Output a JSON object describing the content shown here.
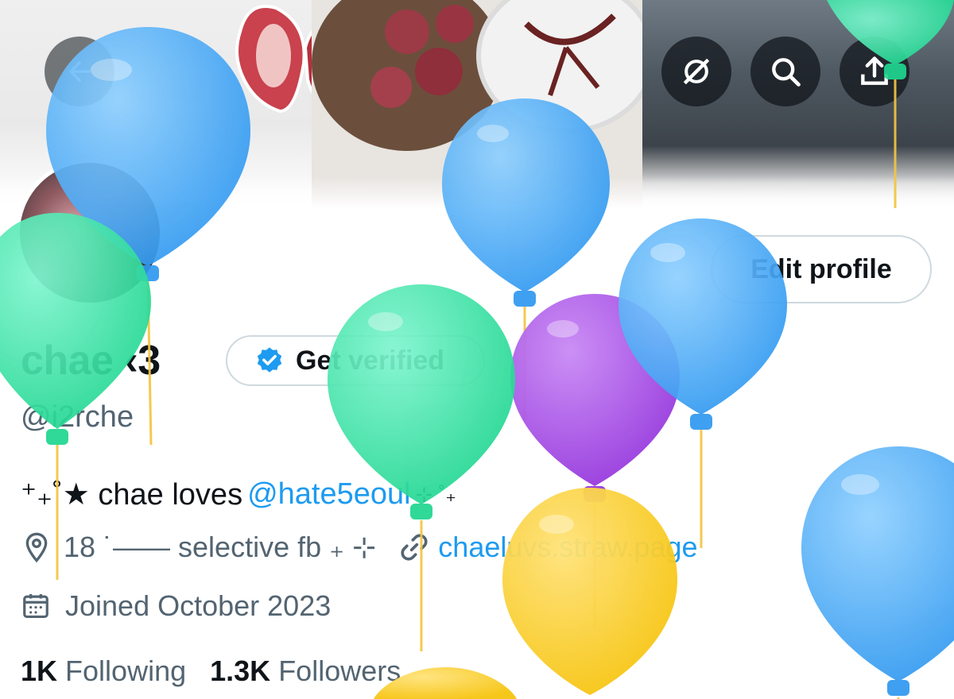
{
  "header": {
    "back_icon": "arrow-left-icon",
    "actions": [
      {
        "name": "grok-icon"
      },
      {
        "name": "search-icon"
      },
      {
        "name": "share-icon"
      }
    ]
  },
  "profile": {
    "display_name": "chae ‹3",
    "handle": "@i2rche",
    "edit_label": "Edit profile",
    "get_verified_label": "Get verified",
    "bio": {
      "prefix": "⁺₊˚★ chae loves",
      "mention": "@hate5eoul",
      "suffix": "⊹ ˚₊"
    },
    "location": "18 ˙—— selective fb ₊ ⊹",
    "website": "chaeluvs.straw.page",
    "joined": "Joined October 2023",
    "following_count": "1K",
    "following_label": "Following",
    "followers_count": "1.3K",
    "followers_label": "Followers"
  },
  "colors": {
    "accent": "#1d9bf0",
    "text_primary": "#0f1419",
    "text_secondary": "#536471",
    "balloon_blue": "#3fa6f5",
    "balloon_green": "#2fe0a6",
    "balloon_purple": "#a24be3",
    "balloon_yellow": "#f8c91d"
  }
}
